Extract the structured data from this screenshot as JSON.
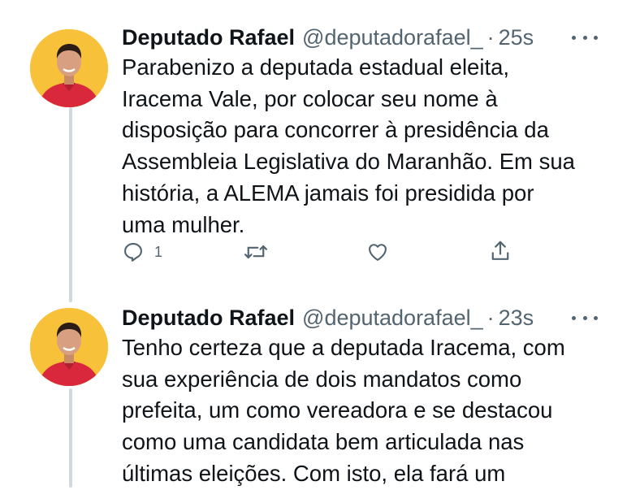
{
  "tweets": [
    {
      "author": "Deputado Rafael",
      "handle": "@deputadorafael_",
      "separator": "·",
      "time": "25s",
      "lines": [
        "Parabenizo a deputada estadual eleita,",
        "Iracema Vale, por colocar seu nome à",
        "disposição para concorrer à presidência da",
        "Assembleia Legislativa do Maranhão. Em sua",
        "história, a ALEMA jamais foi presidida por",
        "uma mulher."
      ],
      "reply_count": "1"
    },
    {
      "author": "Deputado Rafael",
      "handle": "@deputadorafael_",
      "separator": "·",
      "time": "23s",
      "lines": [
        "Tenho certeza que a deputada Iracema, com",
        "sua experiência de dois mandatos como",
        "prefeita, um como vereadora e se destacou",
        "como uma candidata bem articulada nas",
        "últimas eleições. Com isto, ela fará um"
      ]
    }
  ],
  "icons": {
    "reply": "reply-icon",
    "retweet": "retweet-icon",
    "like": "heart-icon",
    "share": "share-icon",
    "more": "more-icon"
  },
  "colors": {
    "text": "#0f1419",
    "secondary": "#536471",
    "thread_line": "#cfd9de",
    "avatar_bg": "#f8c13a",
    "shirt": "#d9283c"
  }
}
